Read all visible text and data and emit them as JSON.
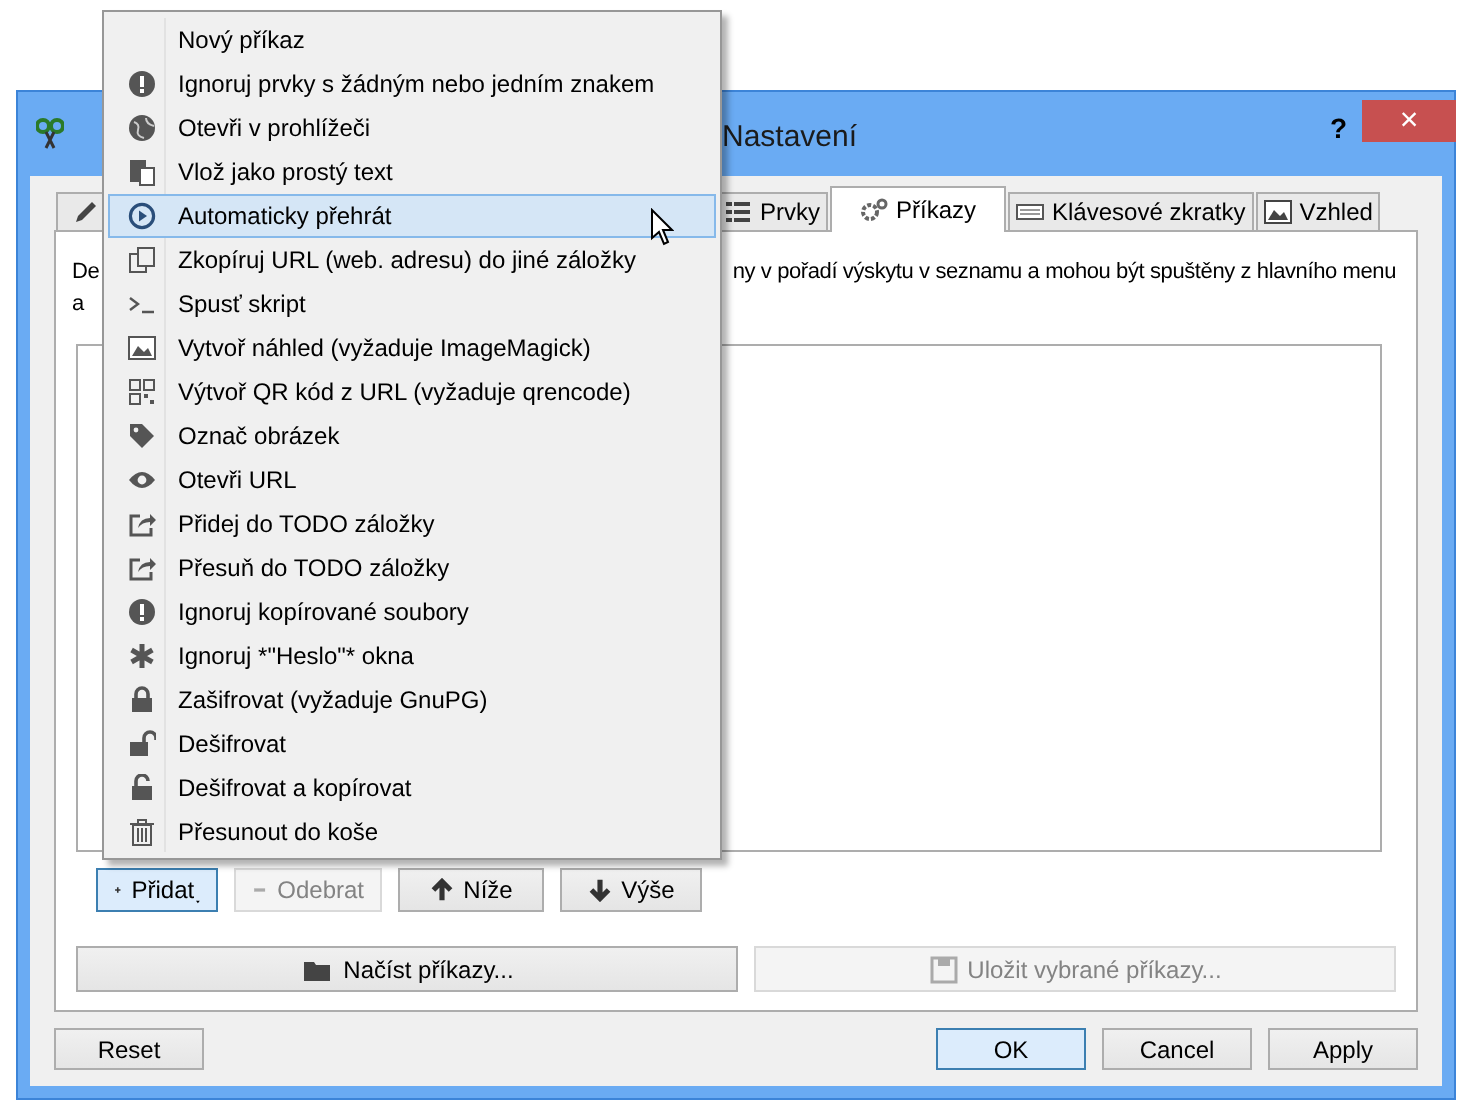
{
  "window": {
    "title": "Nastavení",
    "help": "?",
    "close": "×"
  },
  "tabs": [
    {
      "label": "Prvky",
      "selected": false
    },
    {
      "label": "Příkazy",
      "selected": true
    },
    {
      "label": "Klávesové zkratky",
      "selected": false
    },
    {
      "label": "Vzhled",
      "selected": false
    }
  ],
  "description": {
    "line_1_start": "De",
    "line_1_end": "ny v pořadí výskytu v seznamu a mohou být spuštěny z hlavního menu",
    "line_2_start": "a"
  },
  "command_buttons": [
    {
      "label": "Přidat",
      "disabled": false,
      "focused": true
    },
    {
      "label": "Odebrat",
      "disabled": true,
      "focused": false
    },
    {
      "label": "Níže",
      "disabled": false,
      "focused": false
    },
    {
      "label": "Výše",
      "disabled": false,
      "focused": false
    }
  ],
  "file_buttons": [
    {
      "label": "Načíst příkazy...",
      "disabled": false
    },
    {
      "label": "Uložit vybrané příkazy...",
      "disabled": true
    }
  ],
  "dialog_buttons": [
    {
      "label": "Reset",
      "default": false
    },
    {
      "label": "OK",
      "default": true
    },
    {
      "label": "Cancel",
      "default": false
    },
    {
      "label": "Apply",
      "default": false
    }
  ],
  "menu": [
    {
      "label": "Nový příkaz",
      "selected": false
    },
    {
      "label": "Ignoruj prvky s žádným nebo jedním znakem",
      "selected": false
    },
    {
      "label": "Otevři v prohlížeči",
      "selected": false
    },
    {
      "label": "Vlož jako prostý text",
      "selected": false
    },
    {
      "label": "Automaticky přehrát",
      "selected": true
    },
    {
      "label": "Zkopíruj URL (web. adresu) do jiné záložky",
      "selected": false
    },
    {
      "label": "Spusť skript",
      "selected": false
    },
    {
      "label": "Vytvoř náhled (vyžaduje ImageMagick)",
      "selected": false
    },
    {
      "label": "Výtvoř QR kód z URL (vyžaduje qrencode)",
      "selected": false
    },
    {
      "label": "Označ obrázek",
      "selected": false
    },
    {
      "label": "Otevři URL",
      "selected": false
    },
    {
      "label": "Přidej do TODO záložky",
      "selected": false
    },
    {
      "label": "Přesuň do TODO záložky",
      "selected": false
    },
    {
      "label": "Ignoruj kopírované soubory",
      "selected": false
    },
    {
      "label": "Ignoruj *\"Heslo\"* okna",
      "selected": false
    },
    {
      "label": "Zašifrovat (vyžaduje GnuPG)",
      "selected": false
    },
    {
      "label": "Dešifrovat",
      "selected": false
    },
    {
      "label": "Dešifrovat a kopírovat",
      "selected": false
    },
    {
      "label": "Přesunout do koše",
      "selected": false
    }
  ]
}
